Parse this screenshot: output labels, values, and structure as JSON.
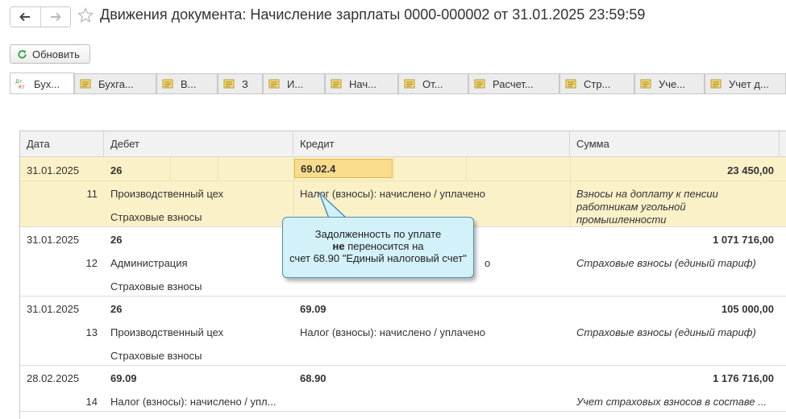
{
  "window": {
    "title": "Движения документа: Начисление зарплаты 0000-000002 от 31.01.2025 23:59:59"
  },
  "nav": {
    "back_icon": "arrow-left-icon",
    "forward_icon": "arrow-right-icon",
    "favorite_icon": "star-icon"
  },
  "toolbar": {
    "refresh_label": "Обновить",
    "refresh_icon": "refresh-icon"
  },
  "tabs": [
    {
      "label": "Бух...",
      "icon": "dt-kt-icon"
    },
    {
      "label": "Бухга...",
      "icon": "register-icon"
    },
    {
      "label": "В...",
      "icon": "register-icon"
    },
    {
      "label": "З",
      "icon": "register-icon"
    },
    {
      "label": "И...",
      "icon": "register-icon"
    },
    {
      "label": "Нач...",
      "icon": "register-icon"
    },
    {
      "label": "От...",
      "icon": "register-icon"
    },
    {
      "label": "Расчет...",
      "icon": "register-icon"
    },
    {
      "label": "Стр...",
      "icon": "register-icon"
    },
    {
      "label": "Уче...",
      "icon": "register-icon"
    },
    {
      "label": "Учет д...",
      "icon": "register-icon"
    }
  ],
  "table": {
    "columns": [
      "Дата",
      "Дебет",
      "Кредит",
      "Сумма"
    ],
    "rows": [
      {
        "date": "31.01.2025",
        "num": "11",
        "debit": "26",
        "debit_sub1": "Производственный цех",
        "debit_sub2": "Страховые взносы",
        "credit": "69.02.4",
        "credit_sub1": "Налог (взносы): начислено / уплачено",
        "credit_sub2": "",
        "amount": "23 450,00",
        "comment": "Взносы на доплату к пенсии работникам угольной промышленности"
      },
      {
        "date": "31.01.2025",
        "num": "12",
        "debit": "26",
        "debit_sub1": "Администрация",
        "debit_sub2": "Страховые взносы",
        "credit": "",
        "credit_sub1": "",
        "credit_sub2": "",
        "amount": "1 071 716,00",
        "comment": "Страховые взносы (единый тариф)"
      },
      {
        "date": "31.01.2025",
        "num": "13",
        "debit": "26",
        "debit_sub1": "Производственный цех",
        "debit_sub2": "Страховые взносы",
        "credit": "69.09",
        "credit_sub1": "Налог (взносы): начислено / уплачено",
        "credit_sub2": "",
        "amount": "105 000,00",
        "comment": "Страховые взносы (единый тариф)"
      },
      {
        "date": "28.02.2025",
        "num": "14",
        "debit": "69.09",
        "debit_sub1": "Налог (взносы): начислено / упл...",
        "debit_sub2": "",
        "credit": "68.90",
        "credit_sub1": "",
        "credit_sub2": "",
        "amount": "1 176 716,00",
        "comment": "Учет страховых взносов в составе ..."
      }
    ]
  },
  "callout": {
    "line1": "Задолженность по уплате",
    "line2_bold": "не",
    "line2_rest": " переносится на",
    "line3": "счет 68.90 \"Единый налоговый счет\""
  }
}
